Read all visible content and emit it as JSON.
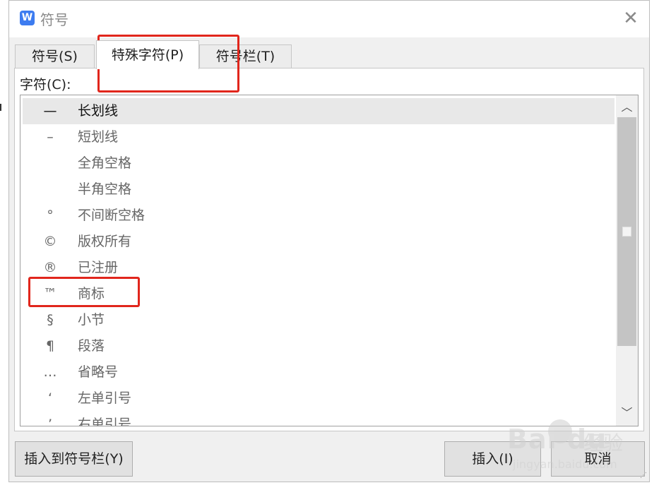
{
  "window": {
    "title": "符号",
    "app_icon": "W",
    "close_glyph": "✕"
  },
  "tabs": [
    {
      "label": "符号(S)",
      "active": false
    },
    {
      "label": "特殊字符(P)",
      "active": true
    },
    {
      "label": "符号栏(T)",
      "active": false
    }
  ],
  "list": {
    "label": "字符(C):",
    "selected_index": 0,
    "items": [
      {
        "symbol": "—",
        "name": "长划线"
      },
      {
        "symbol": "–",
        "name": "短划线"
      },
      {
        "symbol": "",
        "name": "全角空格"
      },
      {
        "symbol": "",
        "name": "半角空格"
      },
      {
        "symbol": "°",
        "name": "不间断空格"
      },
      {
        "symbol": "©",
        "name": "版权所有"
      },
      {
        "symbol": "®",
        "name": "已注册"
      },
      {
        "symbol": "™",
        "name": "商标"
      },
      {
        "symbol": "§",
        "name": "小节"
      },
      {
        "symbol": "¶",
        "name": "段落"
      },
      {
        "symbol": "…",
        "name": "省略号"
      },
      {
        "symbol": "‘",
        "name": "左单引号"
      },
      {
        "symbol": "’",
        "name": "右单引号"
      }
    ]
  },
  "scrollbar": {
    "up_icon": "chevron-up-icon",
    "down_icon": "chevron-down-icon",
    "up_glyph": "︿",
    "down_glyph": "﹀"
  },
  "buttons": {
    "add_to_bar": "插入到符号栏(Y)",
    "insert": "插入(I)",
    "cancel": "取消"
  },
  "watermark": {
    "brand": "Bai  du",
    "cn": "经验",
    "url": "jingyan.baidu.com"
  },
  "colors": {
    "highlight": "#e1261c",
    "app_icon": "#3d7cf0",
    "dialog_bg": "#f0f0f0"
  }
}
